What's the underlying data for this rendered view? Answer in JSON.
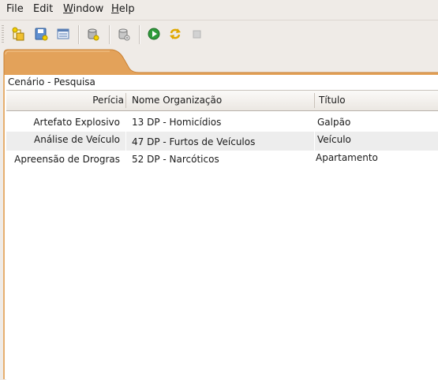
{
  "menu": {
    "file": "File",
    "edit": "Edit",
    "window_rest": "indow",
    "window_mn": "W",
    "help_mn": "H",
    "help_rest": "elp"
  },
  "toolbar": {
    "buttons": [
      {
        "name": "new-open-icon",
        "color": "#d9a300"
      },
      {
        "name": "save-icon",
        "color": "#3c6eb4"
      },
      {
        "name": "properties-icon",
        "color": "#5a7fb5"
      },
      {
        "name": "database-icon",
        "color": "#8a8a8a"
      },
      {
        "name": "database-add-icon",
        "color": "#8a8a8a"
      },
      {
        "name": "run-icon",
        "color": "#2e9b3a"
      },
      {
        "name": "refresh-icon",
        "color": "#e0a800"
      },
      {
        "name": "stop-icon",
        "color": "#c8c8c8"
      }
    ]
  },
  "panel": {
    "title": "Cenário - Pesquisa"
  },
  "table": {
    "columns": [
      "Perícia",
      "Nome Organização",
      "Título"
    ],
    "rows": [
      [
        "Artefato Explosivo",
        "13 DP - Homicídios",
        "Galpão"
      ],
      [
        "Análise de Veículo",
        "47 DP - Furtos de Veículos",
        "Veículo"
      ],
      [
        "Apreensão de Drogras",
        "52 DP - Narcóticos",
        "Apartamento"
      ]
    ]
  },
  "colors": {
    "tab_orange": "#e3a25a",
    "tab_orange_dark": "#d28c41",
    "chrome": "#efebe7"
  }
}
